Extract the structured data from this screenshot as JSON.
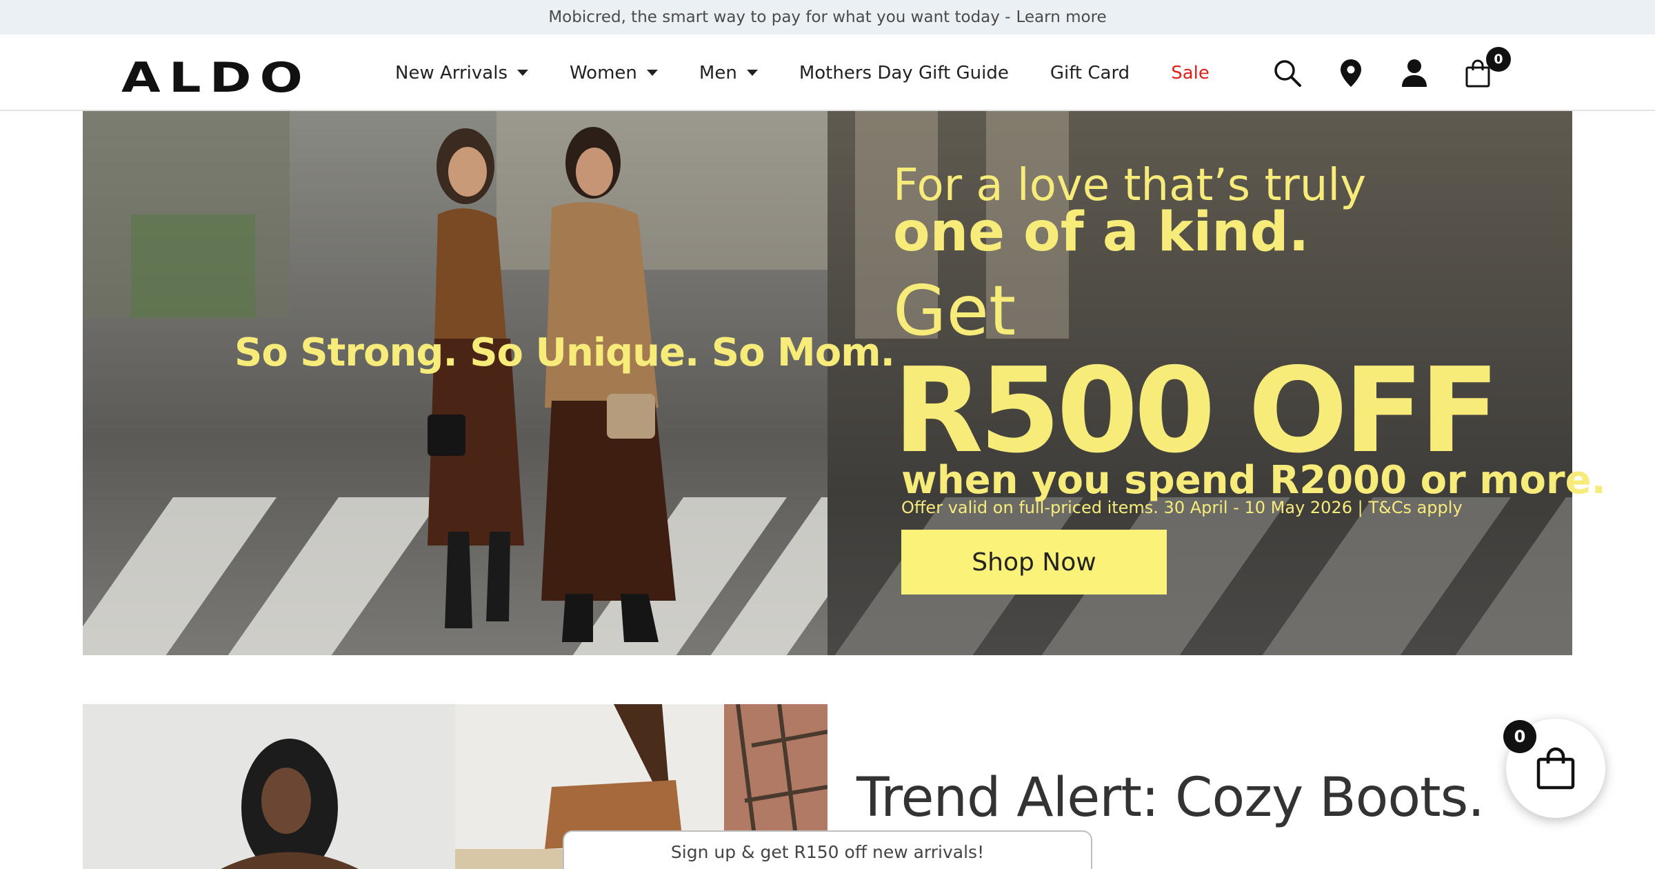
{
  "announcement": {
    "text": "Mobicred, the smart way to pay for what you want today -",
    "link": "Learn more"
  },
  "header": {
    "logo": "ALDO",
    "nav": [
      {
        "label": "New Arrivals",
        "dropdown": true
      },
      {
        "label": "Women",
        "dropdown": true
      },
      {
        "label": "Men",
        "dropdown": true
      },
      {
        "label": "Mothers Day Gift Guide",
        "dropdown": false
      },
      {
        "label": "Gift Card",
        "dropdown": false
      },
      {
        "label": "Sale",
        "dropdown": false
      }
    ],
    "icons": [
      "search-icon",
      "location-pin-icon",
      "account-icon",
      "shopping-bag-icon"
    ],
    "cart_count": "0"
  },
  "hero": {
    "tagline": "So Strong. So Unique. So Mom.",
    "promo_line1": "For a love that’s truly",
    "promo_line2": "one of a kind.",
    "promo_get": "Get",
    "promo_offer": "R500 OFF",
    "promo_spend": "when you spend R2000 or more.",
    "promo_terms": "Offer valid on full-priced items. 30 April - 10 May 2026  | T&Cs apply",
    "cta": "Shop Now"
  },
  "trend": {
    "title": "Trend Alert: Cozy Boots."
  },
  "signup": {
    "text": "Sign up & get R150 off new arrivals!"
  },
  "floating_cart": {
    "count": "0"
  },
  "colors": {
    "accent_yellow": "#f7ec7a",
    "sale_red": "#e1201a",
    "announce_bg": "#ebf0f5"
  }
}
